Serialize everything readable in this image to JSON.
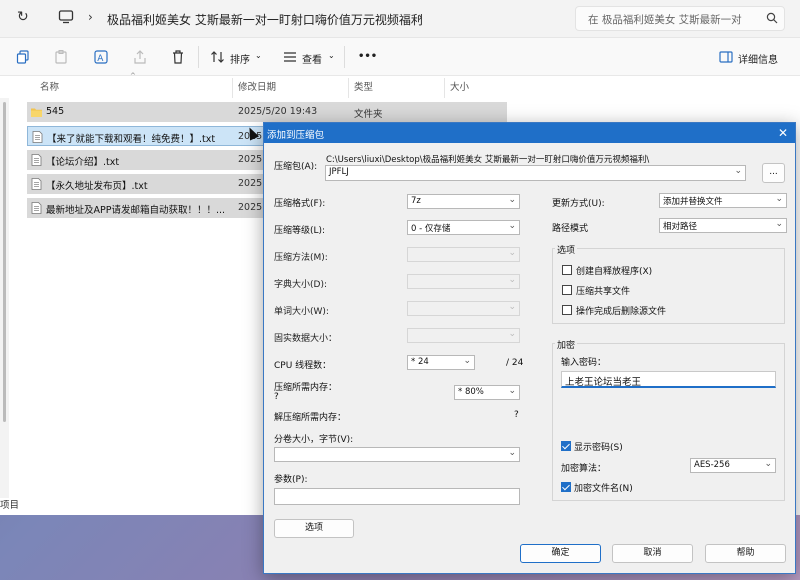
{
  "explorer": {
    "breadcrumb": "极品福利姬美女 艾斯最新一对一盯射口嗨价值万元视频福利",
    "search_placeholder": "在 极品福利姬美女 艾斯最新一对",
    "toolbar": {
      "sort_label": "排序",
      "view_label": "查看",
      "more_label": "•••",
      "details_label": "详细信息"
    },
    "columns": {
      "name": "名称",
      "date": "修改日期",
      "type": "类型",
      "size": "大小"
    },
    "rows": [
      {
        "name": "545",
        "date": "2025/5/20 19:43",
        "type": "文件夹",
        "icon": "folder-icon"
      },
      {
        "name": "【来了就能下载和观看！纯免费！】.txt",
        "date": "2025",
        "type": "",
        "icon": "text-file-icon"
      },
      {
        "name": "【论坛介绍】.txt",
        "date": "2025",
        "type": "",
        "icon": "text-file-icon"
      },
      {
        "name": "【永久地址发布页】.txt",
        "date": "2025",
        "type": "",
        "icon": "text-file-icon"
      },
      {
        "name": "最新地址及APP请发邮箱自动获取！！！...",
        "date": "2025",
        "type": "",
        "icon": "text-file-icon"
      }
    ],
    "status": "项目"
  },
  "dialog": {
    "title": "添加到压缩包",
    "archive_label": "压缩包(A):",
    "archive_path": "C:\\Users\\liuxi\\Desktop\\极品福利姬美女 艾斯最新一对一盯射口嗨价值万元视频福利\\",
    "archive_name": "JPFLJ",
    "browse_label": "...",
    "format_label": "压缩格式(F):",
    "format_value": "7z",
    "level_label": "压缩等级(L):",
    "level_value": "0 - 仅存储",
    "method_label": "压缩方法(M):",
    "dict_label": "字典大小(D):",
    "word_label": "单词大小(W):",
    "solid_label": "固实数据大小：",
    "cpu_label": "CPU 线程数：",
    "cpu_value": "* 24",
    "cpu_max": "/ 24",
    "mem_comp_label": "压缩所需内存：",
    "mem_comp_q": "?",
    "mem_comp_value": "* 80%",
    "mem_decomp_label": "解压缩所需内存：",
    "mem_decomp_q": "?",
    "split_label": "分卷大小，字节(V):",
    "params_label": "参数(P):",
    "options_btn": "选项",
    "update_label": "更新方式(U):",
    "update_value": "添加并替换文件",
    "path_label": "路径模式",
    "path_value": "相对路径",
    "options_group": "选项",
    "opt_sfx": "创建自释放程序(X)",
    "opt_shared": "压缩共享文件",
    "opt_delete": "操作完成后删除源文件",
    "enc_group": "加密",
    "pwd_label": "输入密码：",
    "pwd_value": "上老王论坛当老王",
    "show_pwd": "显示密码(S)",
    "enc_method_label": "加密算法：",
    "enc_method_value": "AES-256",
    "enc_names": "加密文件名(N)",
    "ok": "确定",
    "cancel": "取消",
    "help": "帮助"
  }
}
